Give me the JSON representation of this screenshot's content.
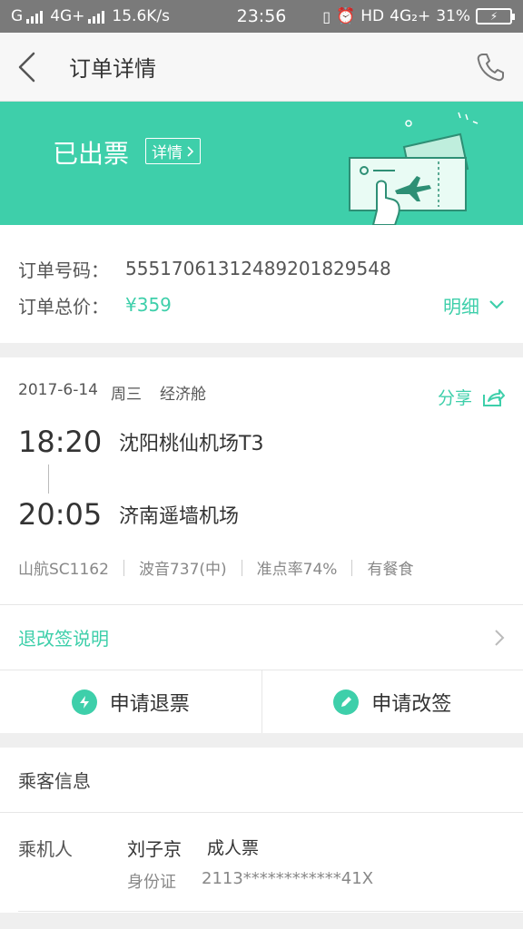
{
  "status_bar": {
    "carrier1": "G",
    "carrier2": "4G+",
    "speed": "15.6K/s",
    "time": "23:56",
    "hd": "HD",
    "net": "4G₂+",
    "battery_pct": "31%"
  },
  "nav": {
    "title": "订单详情"
  },
  "banner": {
    "status": "已出票",
    "detail_label": "详情"
  },
  "order": {
    "number_label": "订单号码：",
    "number_value": "5551706131248920182954​8",
    "total_label": "订单总价：",
    "total_value": "¥359",
    "breakdown_label": "明细"
  },
  "flight": {
    "date": "2017-6-14",
    "weekday": "周三",
    "cabin": "经济舱",
    "share_label": "分享",
    "depart_time": "18:20",
    "depart_airport": "沈阳桃仙机场T3",
    "arrive_time": "20:05",
    "arrive_airport": "济南遥墙机场",
    "flight_no": "山航SC1162",
    "aircraft": "波音737(中)",
    "ontime": "准点率74%",
    "meal": "有餐食"
  },
  "refund_note": "退改签说明",
  "actions": {
    "refund": "申请退票",
    "change": "申请改签"
  },
  "passenger": {
    "section_title": "乘客信息",
    "label": "乘机人",
    "name": "刘子京",
    "ticket_type": "成人票",
    "id_label": "身份证",
    "id_value": "2113************41X"
  },
  "colors": {
    "accent": "#3ecfaa",
    "status_bar": "#7a7a7a"
  }
}
